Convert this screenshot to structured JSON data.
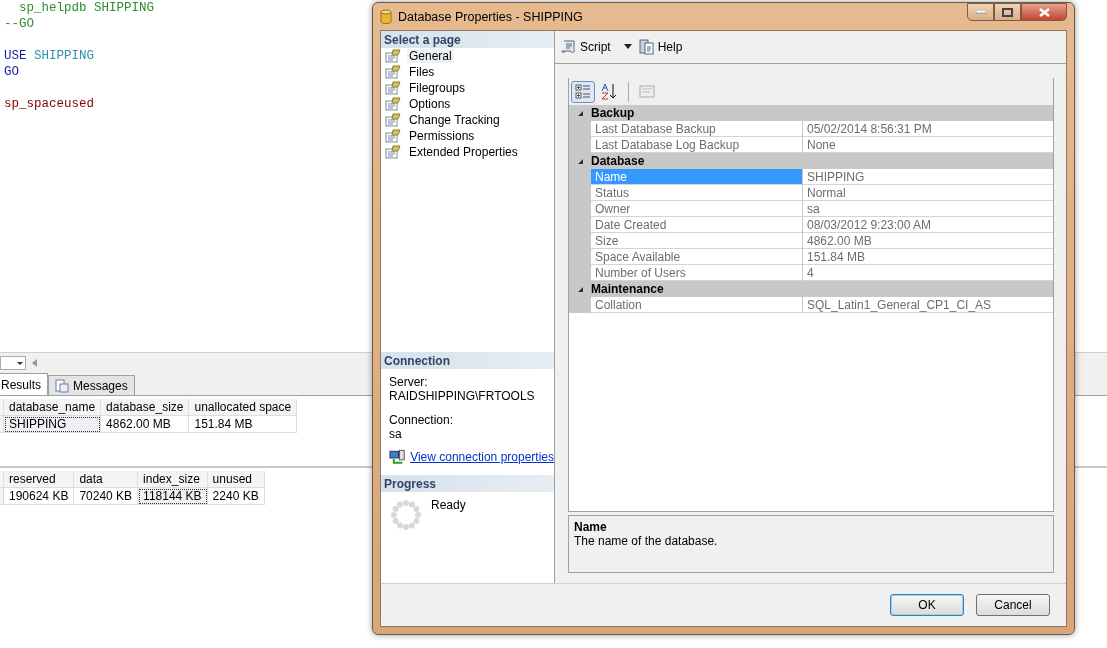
{
  "editor": {
    "lines": [
      {
        "kind": "code",
        "tokens": [
          {
            "kind": "comment",
            "text": "  sp_helpdb SHIPPING"
          }
        ]
      },
      {
        "kind": "code",
        "tokens": [
          {
            "kind": "comment",
            "text": "--GO"
          }
        ]
      },
      {
        "kind": "blank"
      },
      {
        "kind": "code",
        "tokens": [
          {
            "kind": "keyword",
            "text": "USE"
          },
          {
            "kind": "identifier",
            "text": "SHIPPING"
          }
        ]
      },
      {
        "kind": "code",
        "tokens": [
          {
            "kind": "keyword",
            "text": "GO"
          }
        ]
      },
      {
        "kind": "blank"
      },
      {
        "kind": "code",
        "tokens": [
          {
            "kind": "procedure",
            "text": "sp_spaceused"
          }
        ]
      }
    ]
  },
  "results": {
    "tabs": [
      {
        "label": "Results",
        "selected": true
      },
      {
        "label": "Messages",
        "selected": false
      }
    ],
    "grids": [
      {
        "columns": [
          "database_name",
          "database_size",
          "unallocated space"
        ],
        "rows": [
          [
            {
              "text": "SHIPPING",
              "focused": true
            },
            {
              "text": "4862.00 MB",
              "focused": false
            },
            {
              "text": "151.84 MB",
              "focused": false
            }
          ]
        ]
      },
      {
        "columns": [
          "reserved",
          "data",
          "index_size",
          "unused"
        ],
        "rows": [
          [
            {
              "text": "190624 KB",
              "focused": false
            },
            {
              "text": "70240 KB",
              "focused": false
            },
            {
              "text": "118144 KB",
              "focused": true
            },
            {
              "text": "2240 KB",
              "focused": false
            }
          ]
        ]
      }
    ]
  },
  "dialog": {
    "title": "Database Properties - SHIPPING",
    "select_page": {
      "header": "Select a page",
      "pages": [
        {
          "label": "General",
          "selected": true
        },
        {
          "label": "Files",
          "selected": false
        },
        {
          "label": "Filegroups",
          "selected": false
        },
        {
          "label": "Options",
          "selected": false
        },
        {
          "label": "Change Tracking",
          "selected": false
        },
        {
          "label": "Permissions",
          "selected": false
        },
        {
          "label": "Extended Properties",
          "selected": false
        }
      ]
    },
    "connection": {
      "header": "Connection",
      "server_label": "Server:",
      "server": "RAIDSHIPPING\\FRTOOLS",
      "connection_label": "Connection:",
      "connection": "sa",
      "link": "View connection properties"
    },
    "progress": {
      "header": "Progress",
      "status": "Ready"
    },
    "toolbar": [
      {
        "kind": "script",
        "label": "Script"
      },
      {
        "kind": "help",
        "label": "Help"
      }
    ],
    "view_buttons": [
      {
        "kind": "categorized",
        "selected": true
      },
      {
        "kind": "alphabetical",
        "selected": false
      },
      {
        "kind": "property-pages",
        "selected": false
      }
    ],
    "categories": [
      {
        "name": "Backup",
        "expanded": true,
        "properties": [
          {
            "name": "Last Database Backup",
            "value": "05/02/2014 8:56:31 PM",
            "selected": false
          },
          {
            "name": "Last Database Log Backup",
            "value": "None",
            "selected": false
          }
        ]
      },
      {
        "name": "Database",
        "expanded": true,
        "properties": [
          {
            "name": "Name",
            "value": "SHIPPING",
            "selected": true
          },
          {
            "name": "Status",
            "value": "Normal",
            "selected": false
          },
          {
            "name": "Owner",
            "value": "sa",
            "selected": false
          },
          {
            "name": "Date Created",
            "value": "08/03/2012 9:23:00 AM",
            "selected": false
          },
          {
            "name": "Size",
            "value": "4862.00 MB",
            "selected": false
          },
          {
            "name": "Space Available",
            "value": "151.84 MB",
            "selected": false
          },
          {
            "name": "Number of Users",
            "value": "4",
            "selected": false
          }
        ]
      },
      {
        "name": "Maintenance",
        "expanded": true,
        "properties": [
          {
            "name": "Collation",
            "value": "SQL_Latin1_General_CP1_CI_AS",
            "selected": false
          }
        ]
      }
    ],
    "description": {
      "title": "Name",
      "text": "The name of the database."
    },
    "buttons": [
      {
        "label": "OK",
        "default": true
      },
      {
        "label": "Cancel",
        "default": false
      }
    ]
  }
}
